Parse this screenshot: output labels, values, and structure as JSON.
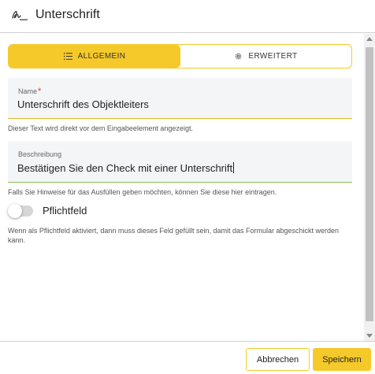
{
  "dialog": {
    "title": "Unterschrift",
    "title_icon": "signature-icon"
  },
  "tabs": [
    {
      "label": "ALLGEMEIN",
      "icon": "list-icon",
      "active": true
    },
    {
      "label": "ERWEITERT",
      "icon": "gear-icon",
      "active": false
    }
  ],
  "fields": {
    "name": {
      "label": "Name",
      "required_mark": "*",
      "value": "Unterschrift des Objektleiters",
      "hint": "Dieser Text wird direkt vor dem Eingabeelement angezeigt."
    },
    "description": {
      "label": "Beschreibung",
      "value": "Bestätigen Sie den Check mit einer Unterschrift",
      "hint": "Falls Sie Hinweise für das Ausfüllen geben möchten, können Sie diese hier eintragen."
    },
    "required": {
      "label": "Pflichtfeld",
      "checked": false,
      "hint": "Wenn als Pflichtfeld aktiviert, dann muss dieses Feld gefüllt sein, damit das Formular abgeschickt werden kann."
    }
  },
  "footer": {
    "cancel_label": "Abbrechen",
    "save_label": "Speichern"
  },
  "colors": {
    "accent": "#f5c92a",
    "required": "#d9342b",
    "valid": "#8bbf5a"
  }
}
